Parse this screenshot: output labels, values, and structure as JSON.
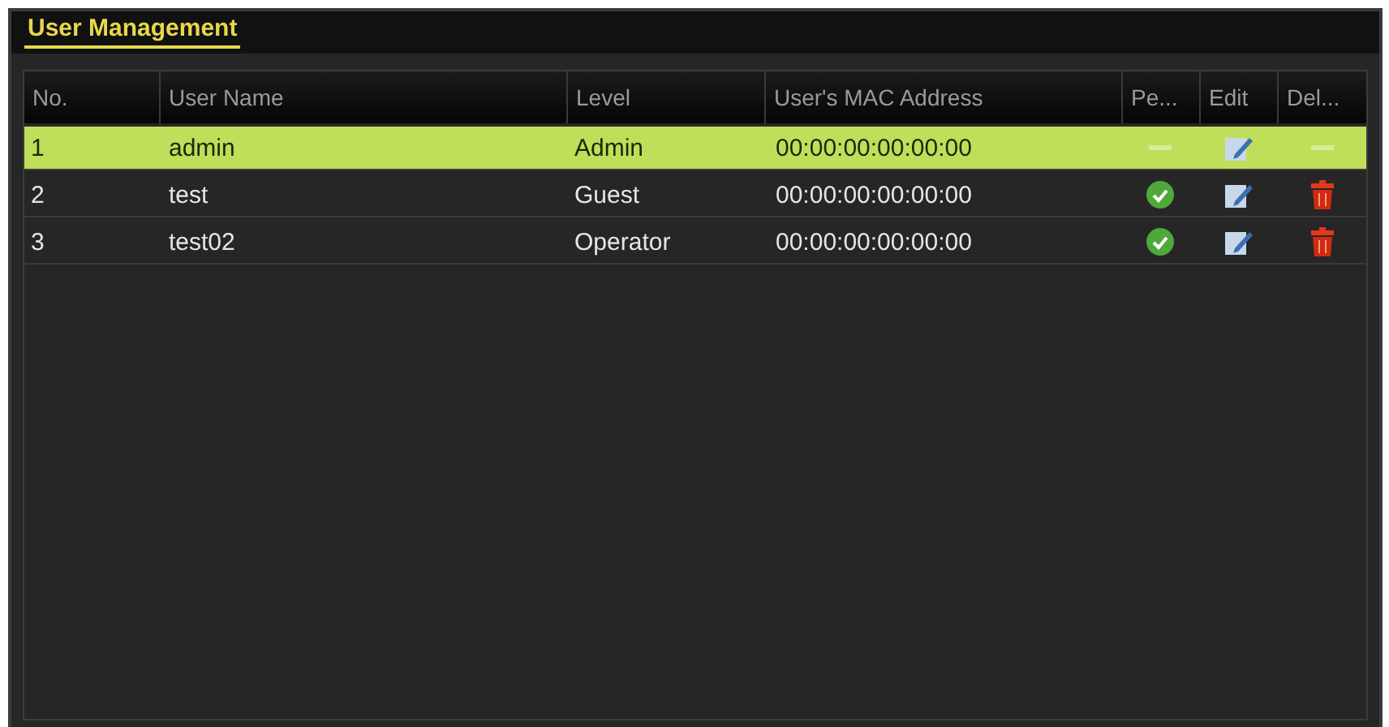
{
  "panel": {
    "title": "User Management"
  },
  "table": {
    "columns": [
      "No.",
      "User Name",
      "Level",
      "User's MAC Address",
      "Pe...",
      "Edit",
      "Del..."
    ],
    "rows": [
      {
        "no": "1",
        "user_name": "admin",
        "level": "Admin",
        "mac": "00:00:00:00:00:00",
        "permission": {
          "kind": "none"
        },
        "delete": {
          "kind": "none"
        },
        "selected": true
      },
      {
        "no": "2",
        "user_name": "test",
        "level": "Guest",
        "mac": "00:00:00:00:00:00",
        "permission": {
          "kind": "check"
        },
        "delete": {
          "kind": "trash"
        },
        "selected": false
      },
      {
        "no": "3",
        "user_name": "test02",
        "level": "Operator",
        "mac": "00:00:00:00:00:00",
        "permission": {
          "kind": "check"
        },
        "delete": {
          "kind": "trash"
        },
        "selected": false
      }
    ]
  }
}
